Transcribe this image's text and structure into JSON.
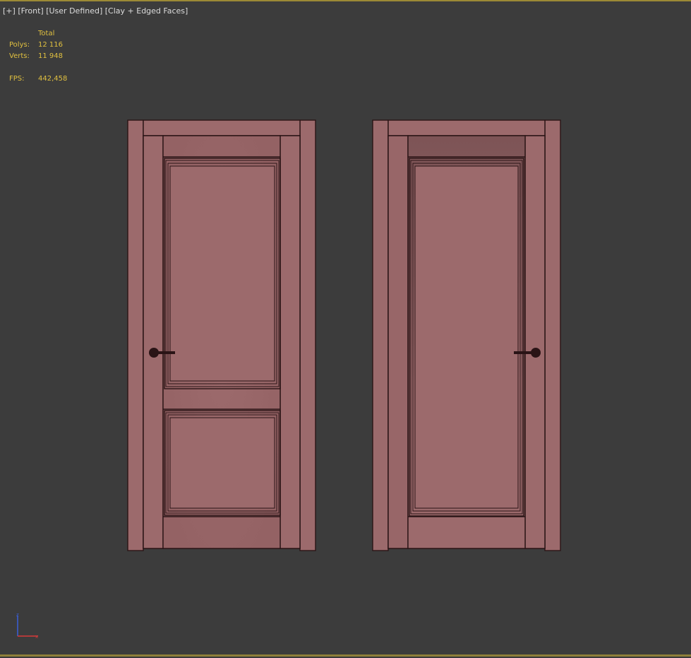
{
  "viewport": {
    "label_plus": "[+]",
    "label_view": "[Front]",
    "label_mode": "[User Defined]",
    "label_shading": "[Clay + Edged Faces]"
  },
  "stats": {
    "header": "Total",
    "polys_label": "Polys:",
    "polys_value": "12 116",
    "verts_label": "Verts:",
    "verts_value": "11 948",
    "fps_label": "FPS:",
    "fps_value": "442,458"
  },
  "colors": {
    "background": "#3c3c3c",
    "clay": "#9c6a6c",
    "edge": "#2a1416",
    "stats_text": "#e0c040",
    "label_text": "#dcdcdc",
    "frame_accent": "#9c8a35"
  },
  "scene": {
    "objects": [
      "door-two-panel",
      "door-single-panel"
    ]
  },
  "axis_gizmo": {
    "icon": "axis-gizmo-icon"
  }
}
